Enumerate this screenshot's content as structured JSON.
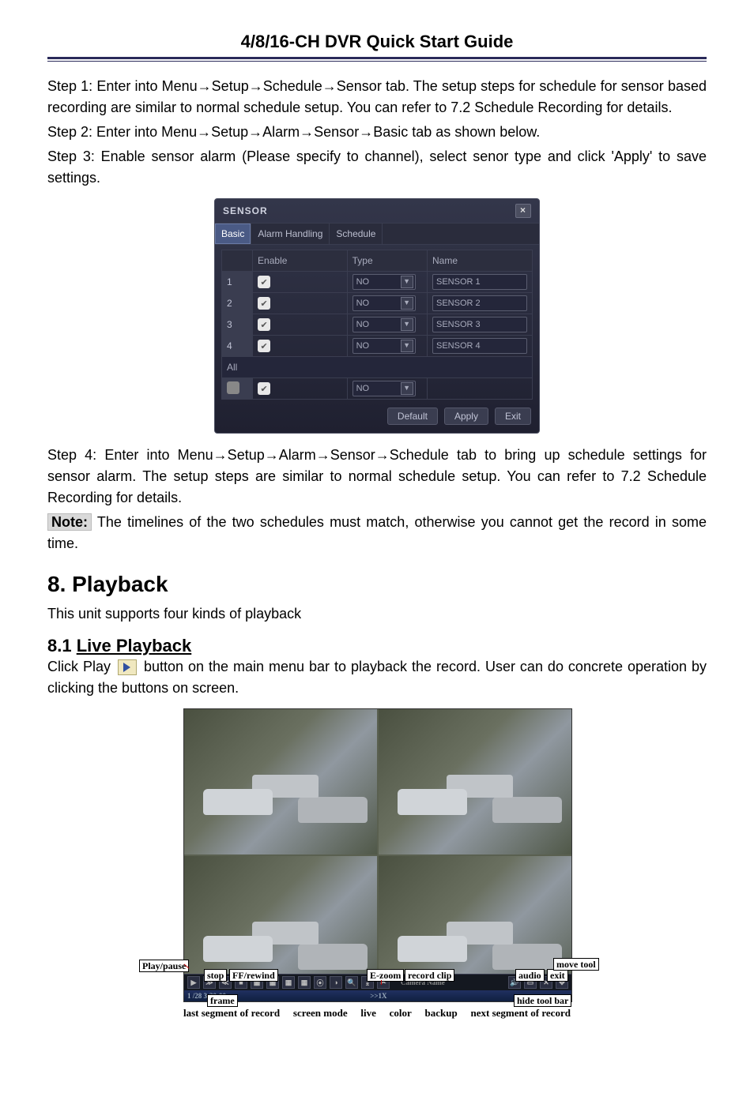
{
  "header_title": "4/8/16-CH DVR Quick Start Guide",
  "steps": {
    "s1": "Step 1: Enter into Menu→Setup→Schedule→Sensor tab. The setup steps for schedule for sensor based recording are similar to normal schedule setup. You can refer to 7.2 Schedule Recording for details.",
    "s2": "Step 2: Enter into Menu→Setup→Alarm→Sensor→Basic tab as shown below.",
    "s3": "Step 3: Enable sensor alarm (Please specify to channel), select senor type and click 'Apply' to save settings.",
    "s4": "Step 4: Enter into Menu→Setup→Alarm→Sensor→Schedule tab to bring up schedule settings for sensor alarm. The setup steps are similar to normal schedule setup. You can refer to 7.2 Schedule Recording for details."
  },
  "note": {
    "label": "Note:",
    "text": " The timelines of the two schedules must match, otherwise you cannot get the record in some time."
  },
  "sensor_dialog": {
    "title": "SENSOR",
    "close": "×",
    "tabs": [
      "Basic",
      "Alarm Handling",
      "Schedule"
    ],
    "headers": [
      "",
      "Enable",
      "Type",
      "Name"
    ],
    "rows": [
      {
        "ch": "1",
        "enable": true,
        "type": "NO",
        "name": "SENSOR 1"
      },
      {
        "ch": "2",
        "enable": true,
        "type": "NO",
        "name": "SENSOR 2"
      },
      {
        "ch": "3",
        "enable": true,
        "type": "NO",
        "name": "SENSOR 3"
      },
      {
        "ch": "4",
        "enable": true,
        "type": "NO",
        "name": "SENSOR 4"
      }
    ],
    "all_label": "All",
    "all_enable": true,
    "all_type": "NO",
    "buttons": {
      "default": "Default",
      "apply": "Apply",
      "exit": "Exit"
    }
  },
  "section8": {
    "title": "8.   Playback",
    "intro": "This unit supports four kinds of playback"
  },
  "section8_1": {
    "title_num": "8.1   ",
    "title_txt": "Live Playback",
    "line1a": "Click Play ",
    "line1b": " button on the main menu bar to playback the record. User can do concrete operation by clicking the buttons on screen."
  },
  "playback_labels": {
    "play_pause": "Play/pause",
    "stop": "stop",
    "ff_rewind": "FF/rewind",
    "move_tool": "move tool",
    "ezoom": "E-zoom",
    "record_clip": "record clip",
    "audio": "audio",
    "exit": "exit",
    "frame": "frame",
    "hide_tool_bar": "hide tool bar",
    "last_segment": "last segment of record",
    "screen_mode": "screen mode",
    "live": "live",
    "color": "color",
    "backup": "backup",
    "next_segment": "next segment of record",
    "camera_name": "Camera Name",
    "time": "1 /28 3:30:00",
    "speed": ">>1X"
  }
}
